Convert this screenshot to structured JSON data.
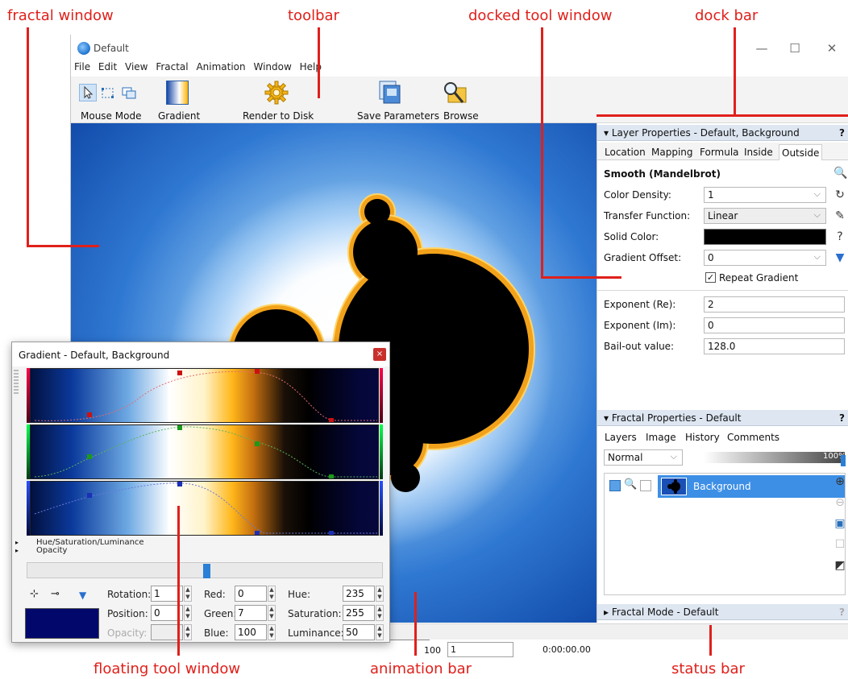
{
  "callouts": {
    "fractal_window": "fractal window",
    "toolbar": "toolbar",
    "docked_tool_window": "docked tool window",
    "dock_bar": "dock bar",
    "floating_tool_window": "floating tool window",
    "animation_bar": "animation bar",
    "status_bar": "status bar"
  },
  "window": {
    "title": "Default"
  },
  "menu": [
    "File",
    "Edit",
    "View",
    "Fractal",
    "Animation",
    "Window",
    "Help"
  ],
  "toolbar": {
    "mouse_mode": "Mouse Mode",
    "gradient": "Gradient",
    "render_to_disk": "Render to Disk",
    "save_parameters": "Save Parameters",
    "browse": "Browse"
  },
  "layer_panel": {
    "title": "Layer Properties - Default, Background",
    "help": "?",
    "tabs": [
      "Location",
      "Mapping",
      "Formula",
      "Inside",
      "Outside"
    ],
    "section_title": "Smooth (Mandelbrot)",
    "color_density_label": "Color Density:",
    "color_density_value": "1",
    "transfer_function_label": "Transfer Function:",
    "transfer_function_value": "Linear",
    "solid_color_label": "Solid Color:",
    "gradient_offset_label": "Gradient Offset:",
    "gradient_offset_value": "0",
    "repeat_gradient_label": "Repeat Gradient",
    "exponent_re_label": "Exponent (Re):",
    "exponent_re_value": "2",
    "exponent_im_label": "Exponent (Im):",
    "exponent_im_value": "0",
    "bailout_label": "Bail-out value:",
    "bailout_value": "128.0"
  },
  "fractal_panel": {
    "title": "Fractal Properties - Default",
    "help": "?",
    "tabs": [
      "Layers",
      "Image",
      "History",
      "Comments"
    ],
    "blend_mode": "Normal",
    "opacity": "100%",
    "layer_name": "Background"
  },
  "fractal_mode_panel": {
    "title": "Fractal Mode - Default",
    "help": "?"
  },
  "animation": {
    "tick_label": "100",
    "frame_value": "1",
    "time": "0:00:00.00"
  },
  "gradient_window": {
    "title": "Gradient - Default, Background",
    "close": "×",
    "hsl_label": "Hue/Saturation/Luminance",
    "opacity_label": "Opacity",
    "rotation_label": "Rotation:",
    "rotation_value": "1",
    "position_label": "Position:",
    "position_value": "0",
    "opacity_field_label": "Opacity:",
    "red_label": "Red:",
    "red_value": "0",
    "green_label": "Green:",
    "green_value": "7",
    "blue_label": "Blue:",
    "blue_value": "100",
    "hue_label": "Hue:",
    "hue_value": "235",
    "saturation_label": "Saturation:",
    "saturation_value": "255",
    "luminance_label": "Luminance:",
    "luminance_value": "50",
    "swatch_color": "#02086b"
  }
}
